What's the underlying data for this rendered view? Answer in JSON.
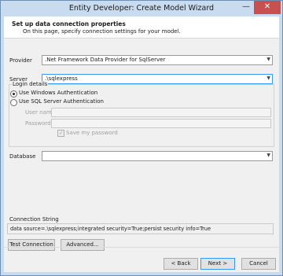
{
  "window": {
    "title": "Entity Developer: Create Model Wizard",
    "minimize_glyph": "—",
    "close_glyph": "✕"
  },
  "header": {
    "title": "Set up data connection properties",
    "subtitle": "On this page, specify connection settings for your model."
  },
  "provider": {
    "label": "Provider",
    "value": ".Net Framework Data Provider for SqlServer"
  },
  "server": {
    "label": "Server",
    "value": ".\\sqlexpress"
  },
  "login": {
    "group_label": "Login details",
    "windows_auth": "Use Windows Authentication",
    "sql_auth": "Use SQL Server Authentication",
    "selected": "windows",
    "user_name_label": "User name",
    "password_label": "Password",
    "save_password_label": "Save my password",
    "save_password_checked": true
  },
  "database": {
    "label": "Database",
    "value": ""
  },
  "connection_string": {
    "label": "Connection String",
    "value": "data source=.\\sqlexpress;integrated security=True;persist security info=True"
  },
  "buttons": {
    "test_connection": "Test Connection",
    "advanced": "Advanced...",
    "back": "< Back",
    "next": "Next >",
    "cancel": "Cancel"
  },
  "icons": {
    "dropdown": "chevron-down-icon",
    "check": "checkmark-icon"
  },
  "colors": {
    "accent": "#3399ff",
    "close_button": "#c75050",
    "window_frame": "#c9dbef"
  }
}
